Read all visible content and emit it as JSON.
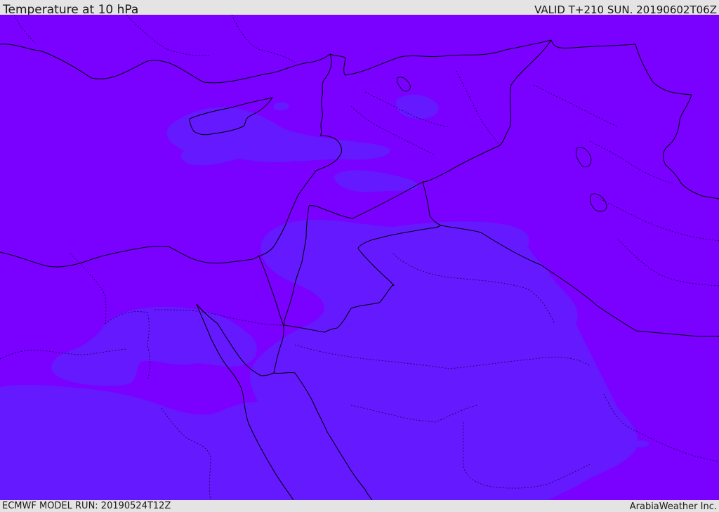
{
  "header": {
    "title": "Temperature at 10 hPa",
    "valid_time": "VALID T+210 SUN. 20190602T06Z"
  },
  "footer": {
    "model_run": "ECMWF MODEL RUN: 20190524T12Z",
    "credit": "ArabiaWeather Inc."
  },
  "map": {
    "background_color": "#7a00ff",
    "contour_fill_color": "#6419ff",
    "border_color": "#000000"
  }
}
